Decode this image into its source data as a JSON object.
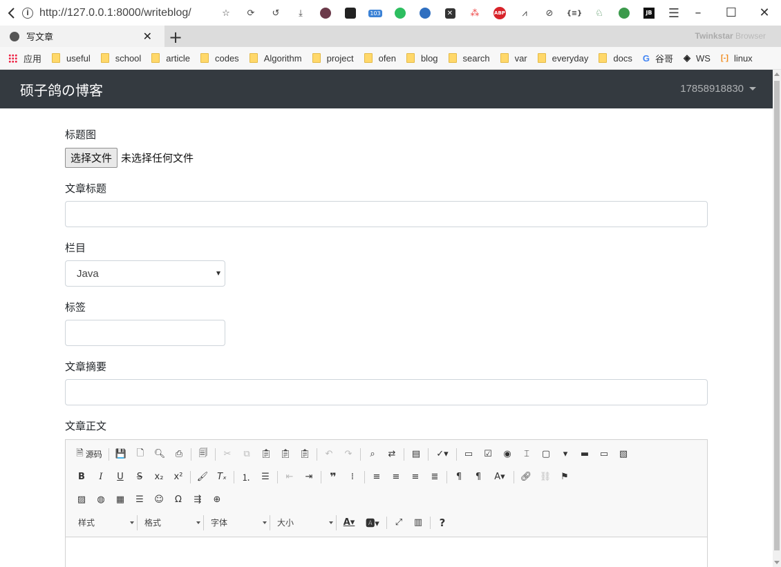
{
  "browser": {
    "url": "http://127.0.0.1:8000/writeblog/",
    "tab_title": "写文章",
    "brand_name": "Twinkstar",
    "brand_suffix": " Browser",
    "extensions": {
      "badge_count": "103",
      "abp_label": "ABP",
      "json_label": "{≡}",
      "jb_label": "JB"
    },
    "bookmarks": [
      {
        "label": "应用",
        "icon": "apps-grid-icon"
      },
      {
        "label": "useful",
        "icon": "folder-icon"
      },
      {
        "label": "school",
        "icon": "folder-icon"
      },
      {
        "label": "article",
        "icon": "folder-icon"
      },
      {
        "label": "codes",
        "icon": "folder-icon"
      },
      {
        "label": "Algorithm",
        "icon": "folder-icon"
      },
      {
        "label": "project",
        "icon": "folder-icon"
      },
      {
        "label": "ofen",
        "icon": "folder-icon"
      },
      {
        "label": "blog",
        "icon": "folder-icon"
      },
      {
        "label": "search",
        "icon": "folder-icon"
      },
      {
        "label": "var",
        "icon": "folder-icon"
      },
      {
        "label": "everyday",
        "icon": "folder-icon"
      },
      {
        "label": "docs",
        "icon": "folder-icon"
      },
      {
        "label": "谷哥",
        "icon": "google-icon"
      },
      {
        "label": "WS",
        "icon": "stack-icon"
      },
      {
        "label": "linux",
        "icon": "bracket-icon"
      }
    ]
  },
  "site": {
    "title": "硕子鸽の博客",
    "user": "17858918830"
  },
  "form": {
    "cover_label": "标题图",
    "file_button": "选择文件",
    "file_status": "未选择任何文件",
    "title_label": "文章标题",
    "title_value": "",
    "category_label": "栏目",
    "category_value": "Java",
    "tags_label": "标签",
    "tags_value": "",
    "summary_label": "文章摘要",
    "summary_value": "",
    "body_label": "文章正文"
  },
  "editor": {
    "source_label": "源码",
    "combos": {
      "styles": "样式",
      "format": "格式",
      "font": "字体",
      "size": "大小"
    },
    "help_label": "?"
  }
}
